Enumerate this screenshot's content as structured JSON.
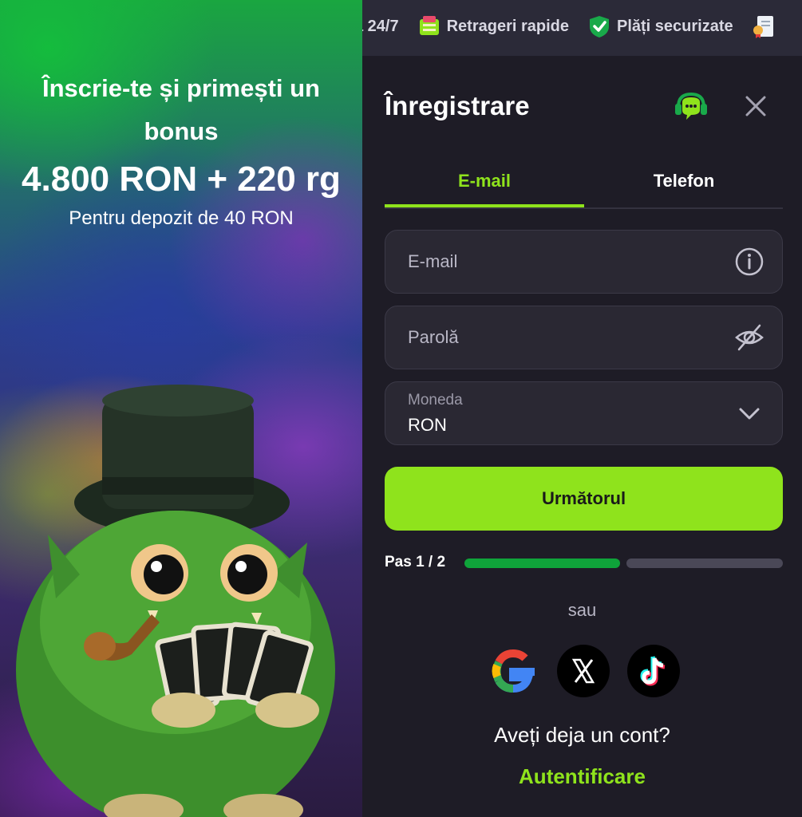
{
  "promo": {
    "headline": "Înscrie-te și primești un bonus",
    "amount": "4.800 RON + 220 rg",
    "subtitle": "Pentru depozit de 40 RON"
  },
  "topbar": {
    "items": [
      {
        "label": "ă 24/7",
        "icon": "support-icon"
      },
      {
        "label": "Retrageri rapide",
        "icon": "money-icon"
      },
      {
        "label": "Plăți securizate",
        "icon": "shield-check-icon"
      },
      {
        "label": "",
        "icon": "certificate-icon"
      }
    ]
  },
  "form": {
    "title": "Înregistrare",
    "tabs": [
      {
        "label": "E-mail",
        "active": true
      },
      {
        "label": "Telefon",
        "active": false
      }
    ],
    "email_placeholder": "E-mail",
    "password_placeholder": "Parolă",
    "currency_label": "Moneda",
    "currency_value": "RON",
    "next_label": "Următorul",
    "step_label": "Pas 1 / 2",
    "step_progress": 0.5,
    "or_label": "sau",
    "social": [
      "google-icon",
      "x-icon",
      "tiktok-icon"
    ],
    "have_account": "Aveți deja un cont?",
    "login_link": "Autentificare"
  },
  "colors": {
    "accent": "#8fe31c",
    "progress": "#0fa33a",
    "panel_bg": "#1e1c26",
    "field_bg": "#2a2833"
  }
}
